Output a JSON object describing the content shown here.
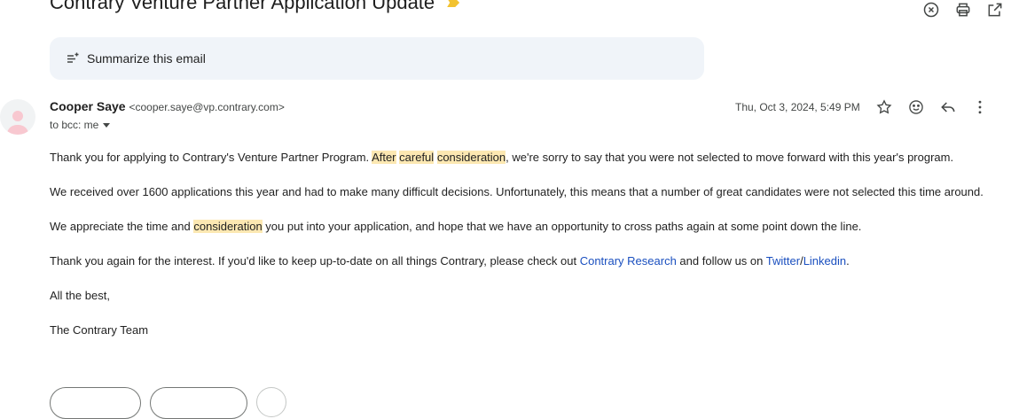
{
  "email": {
    "subject": "Contrary Venture Partner Application Update",
    "summarize_label": "Summarize this email",
    "sender": {
      "name": "Cooper Saye",
      "email": "<cooper.saye@vp.contrary.com>"
    },
    "recipient": "to bcc: me",
    "date": "Thu, Oct 3, 2024, 5:49 PM",
    "body": {
      "p1": {
        "before": "Thank you for applying to Contrary's Venture Partner Program. ",
        "h1": "After",
        "h2": "careful",
        "h3": "consideration",
        "after": ", we're sorry to say that you were not selected to move forward with this year's program."
      },
      "p2": "We received over 1600 applications this year and had to make many difficult decisions. Unfortunately, this means that a number of great candidates were not selected this time around.",
      "p3": {
        "before": "We appreciate the time and ",
        "h1": "consideration",
        "after": " you put into your application, and hope that we have an opportunity to cross paths again at some point down the line."
      },
      "p4": {
        "before": "Thank you again for the interest. If you'd like to keep up-to-date on all things Contrary, please check out ",
        "link1": "Contrary Research",
        "middle": " and follow us on ",
        "link2": "Twitter",
        "sep": "/",
        "link3": "Linkedin",
        "end": "."
      },
      "p5": "All the best,",
      "p6": "The Contrary Team"
    }
  },
  "colors": {
    "highlight": "#fce8b2",
    "link": "#1a4fbf",
    "summarize_bg": "#f0f4f9",
    "label_tag": "#f2c230"
  }
}
